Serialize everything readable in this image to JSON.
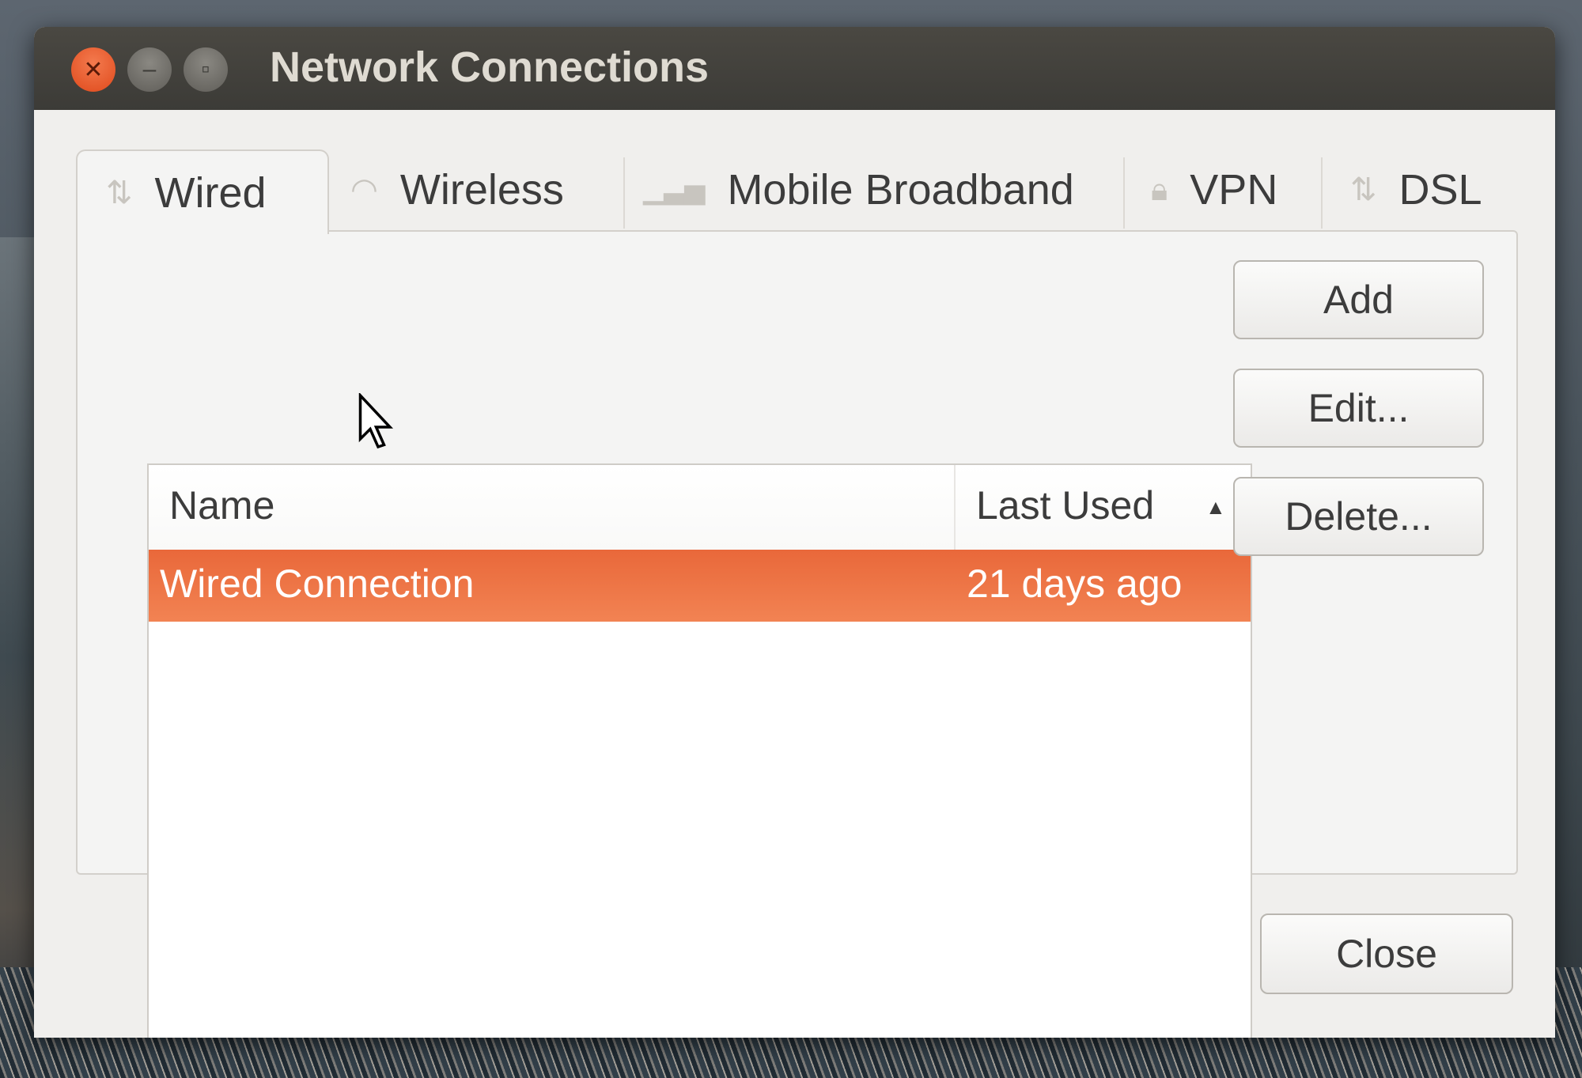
{
  "window": {
    "title": "Network Connections"
  },
  "tabs": [
    {
      "label": "Wired",
      "icon": "network-arrows-icon",
      "active": true
    },
    {
      "label": "Wireless",
      "icon": "wifi-icon",
      "active": false
    },
    {
      "label": "Mobile Broadband",
      "icon": "signal-bars-icon",
      "active": false
    },
    {
      "label": "VPN",
      "icon": "lock-icon",
      "active": false
    },
    {
      "label": "DSL",
      "icon": "network-arrows-icon",
      "active": false
    }
  ],
  "table": {
    "columns": [
      "Name",
      "Last Used"
    ],
    "sort": "ascending",
    "rows": [
      {
        "name": "Wired Connection",
        "last_used": "21 days ago",
        "selected": true
      }
    ]
  },
  "buttons": {
    "add": "Add",
    "edit": "Edit...",
    "delete": "Delete...",
    "close": "Close"
  },
  "colors": {
    "accent": "#ea6c3e",
    "titlebar": "#3c3b37"
  }
}
